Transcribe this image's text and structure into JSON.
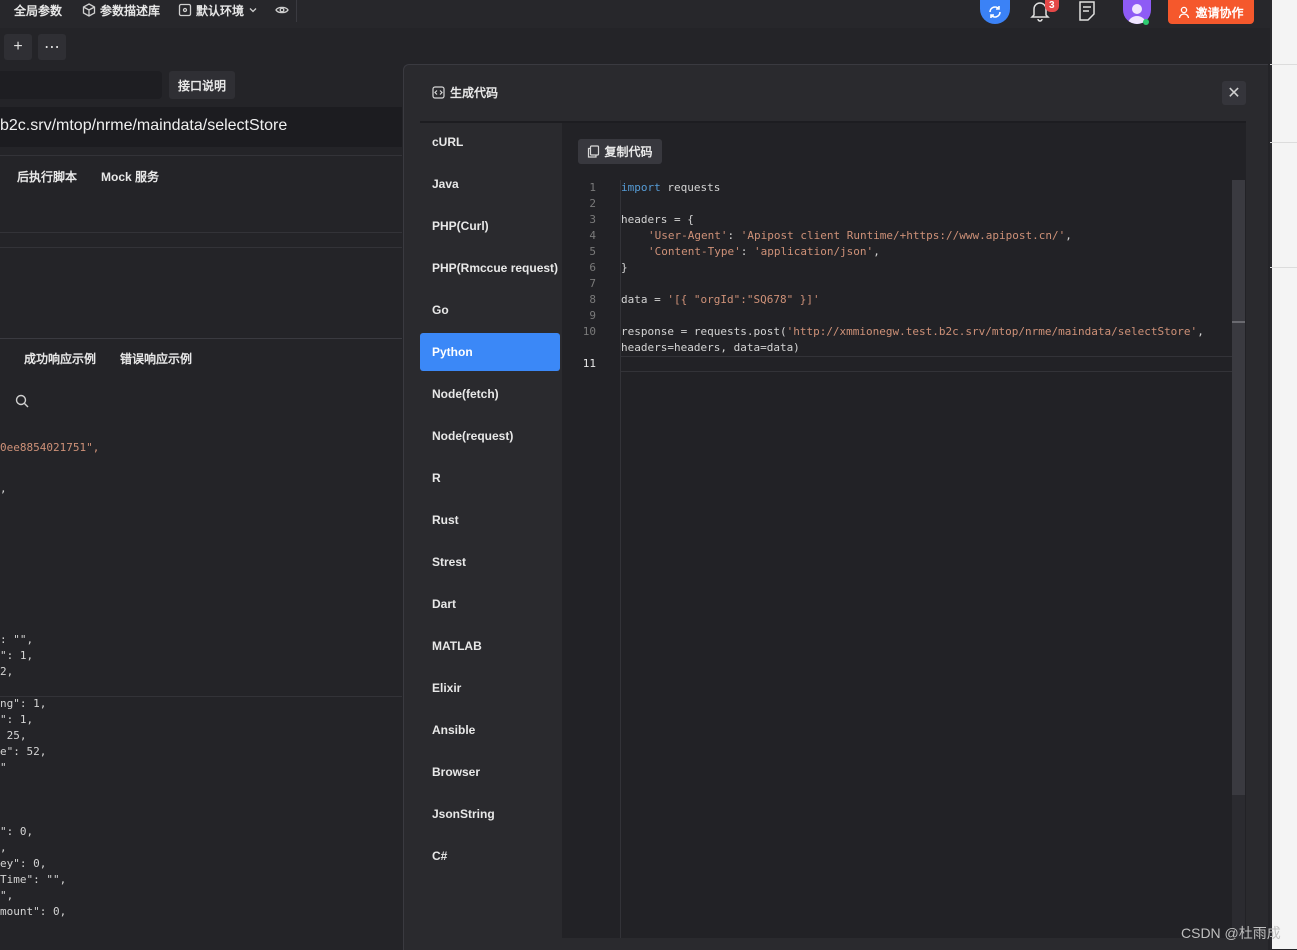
{
  "topbar": {
    "global_params": "全局参数",
    "param_lib": "参数描述库",
    "env": "默认环境",
    "notif_count": "3",
    "invite": "邀请协作"
  },
  "background": {
    "api_desc": "接口说明",
    "url": "b2c.srv/mtop/nrme/maindata/selectStore",
    "tab_post_script": "后执行脚本",
    "tab_mock": "Mock 服务",
    "tab_success": "成功响应示例",
    "tab_error": "错误响应示例",
    "code_lines": [
      "0ee8854021751\",",
      ",",
      ": \"\",",
      "\": 1,",
      "2,",
      "ng\": 1,",
      "\": 1,",
      " 25,",
      "e\": 52,",
      "\"",
      "\": 0,",
      ",",
      "ey\": 0,",
      "Time\": \"\",",
      "\",",
      "mount\": 0,"
    ]
  },
  "modal": {
    "title": "生成代码",
    "close": "✕",
    "copy": "复制代码",
    "languages": [
      "cURL",
      "Java",
      "PHP(Curl)",
      "PHP(Rmccue request)",
      "Go",
      "Python",
      "Node(fetch)",
      "Node(request)",
      "R",
      "Rust",
      "Strest",
      "Dart",
      "MATLAB",
      "Elixir",
      "Ansible",
      "Browser",
      "JsonString",
      "C#"
    ],
    "active_language": "Python",
    "line_numbers": [
      "1",
      "2",
      "3",
      "4",
      "5",
      "6",
      "7",
      "8",
      "9",
      "10",
      "11"
    ],
    "code": {
      "l1_kw": "import",
      "l1_rest": " requests",
      "l3": "headers = {",
      "l4_key": "'User-Agent'",
      "l4_colon": ": ",
      "l4_val": "'Apipost client Runtime/+https://www.apipost.cn/'",
      "l4_end": ",",
      "l5_key": "'Content-Type'",
      "l5_colon": ": ",
      "l5_val": "'application/json'",
      "l5_end": ",",
      "l6": "}",
      "l8_a": "data = ",
      "l8_str": "'[{ \"orgId\":\"SQ678\" }]'",
      "l10_a": "response = requests.post(",
      "l10_url": "'http://xmmionegw.test.b2c.srv/mtop/nrme/maindata/selectStore'",
      "l10_end": ",",
      "l10b": "headers=headers, data=data)"
    }
  },
  "watermark": "CSDN @杜雨成",
  "colors": {
    "accent": "#3b88f7",
    "invite": "#f5582c",
    "string": "#ce9178",
    "keyword": "#569cd6"
  }
}
